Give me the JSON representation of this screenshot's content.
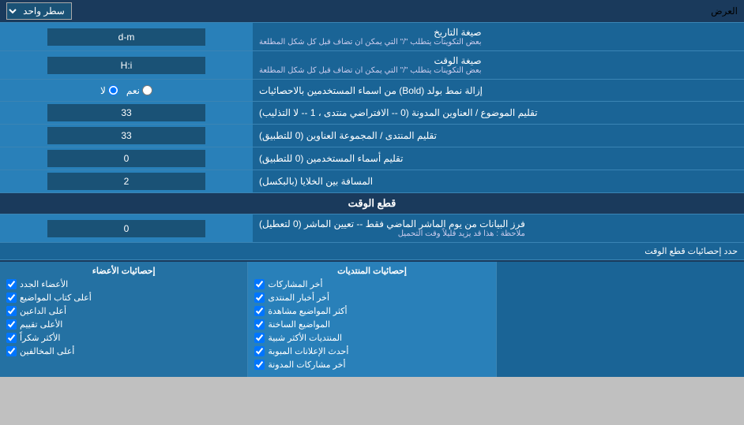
{
  "top": {
    "label": "العرض",
    "select_value": "سطر واحد"
  },
  "date_format": {
    "label": "صيغة التاريخ",
    "sub_label": "بعض التكوينات يتطلب \"/\" التي يمكن ان تضاف قبل كل شكل المطلعة",
    "value": "d-m"
  },
  "time_format": {
    "label": "صيغة الوقت",
    "sub_label": "بعض التكوينات يتطلب \"/\" التي يمكن ان تضاف قبل كل شكل المطلعة",
    "value": "H:i"
  },
  "bold_setting": {
    "label": "إزالة نمط بولد (Bold) من اسماء المستخدمين بالاحصائيات",
    "radio_yes": "نعم",
    "radio_no": "لا",
    "selected": "no"
  },
  "topics_threads": {
    "label": "تقليم الموضوع / العناوين المدونة (0 -- الافتراضي منتدى ، 1 -- لا التذليب)",
    "value": "33"
  },
  "forum_group": {
    "label": "تقليم المنتدى / المجموعة العناوين (0 للتطبيق)",
    "value": "33"
  },
  "usernames": {
    "label": "تقليم أسماء المستخدمين (0 للتطبيق)",
    "value": "0"
  },
  "cell_spacing": {
    "label": "المسافة بين الخلايا (بالبكسل)",
    "value": "2"
  },
  "time_cutoff_section": "قطع الوقت",
  "time_cutoff": {
    "label": "فرز البيانات من يوم الماشر الماضي فقط -- تعيين الماشر (0 لتعطيل)",
    "note": "ملاحظة : هذا قد يزيد قليلاً وقت التحميل",
    "value": "0"
  },
  "limit_section": "حدد إحصائيات قطع الوقت",
  "checkboxes": {
    "col1_header": "إحصائيات الأعضاء",
    "col2_header": "إحصائيات المنتديات",
    "col3_header": "",
    "col1": [
      "الأعضاء الجدد",
      "أعلى كتاب المواضيع",
      "أعلى الداعين",
      "الأعلى تقييم",
      "الأكثر شكراً",
      "أعلى المخالفين"
    ],
    "col2": [
      "أخر المشاركات",
      "أخر أخبار المنتدى",
      "أكثر المواضيع مشاهدة",
      "المواضيع الساخنة",
      "المنتديات الأكثر شبية",
      "أحدث الإعلانات المبوبة",
      "أخر مشاركات المدونة"
    ]
  }
}
